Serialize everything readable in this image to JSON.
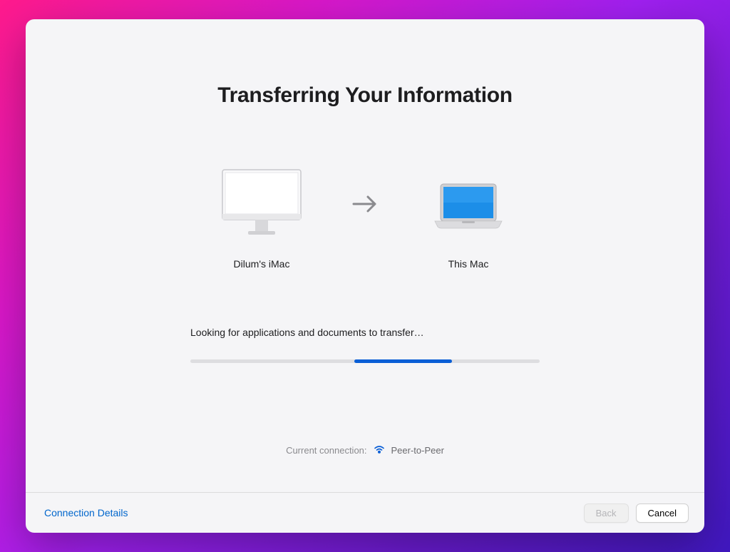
{
  "title": "Transferring Your Information",
  "devices": {
    "source": {
      "label": "Dilum's iMac"
    },
    "destination": {
      "label": "This Mac"
    }
  },
  "status": {
    "text": "Looking for applications and documents to transfer…"
  },
  "connection": {
    "label": "Current connection:",
    "type": "Peer-to-Peer"
  },
  "footer": {
    "details_link": "Connection Details",
    "back_label": "Back",
    "cancel_label": "Cancel"
  }
}
